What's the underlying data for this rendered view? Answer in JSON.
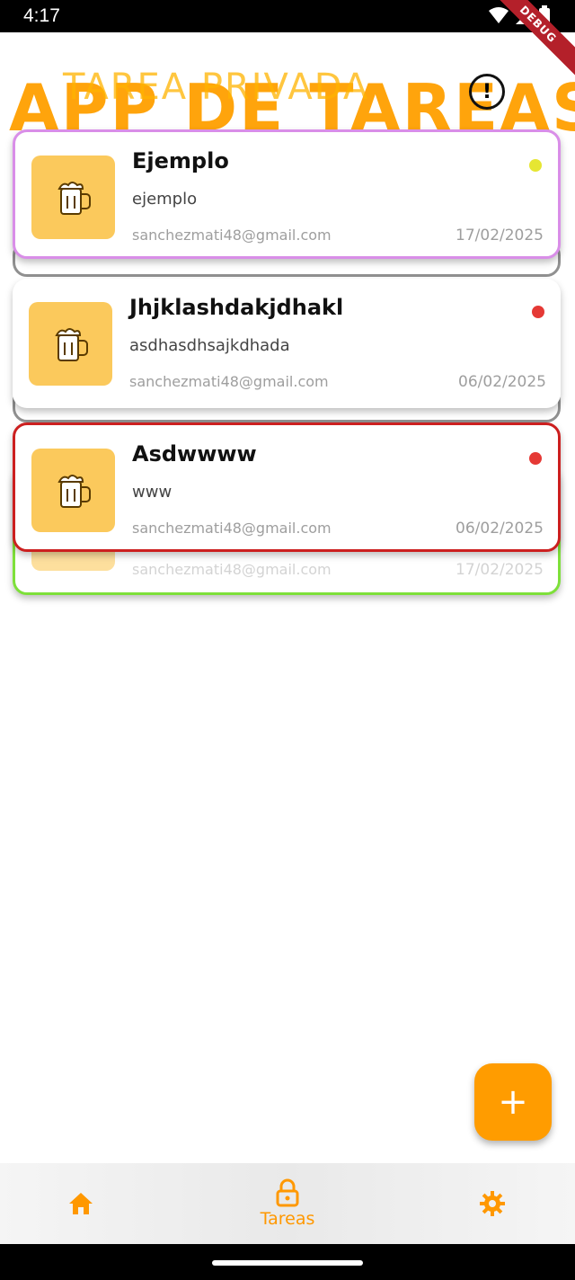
{
  "status_bar": {
    "time": "4:17",
    "debug_banner": "DEBUG"
  },
  "header": {
    "app_title": "APP DE TAREAS",
    "screen_title": "TAREA PRIVADA"
  },
  "tasks": [
    {
      "title": "Ejemplo",
      "description": "ejemplo",
      "email": "sanchezmati48@gmail.com",
      "date": "17/02/2025",
      "priority_color": "#e6e632",
      "border_color": "#d98ee8",
      "thumb_icon": "beer-mug-icon"
    },
    {
      "title": "Jhjklashdakjdhakl",
      "description": "asdhasdhsajkdhada",
      "email": "sanchezmati48@gmail.com",
      "date": "06/02/2025",
      "priority_color": "#e53935",
      "border_color": "",
      "thumb_icon": "beer-mug-icon"
    },
    {
      "title": "Asdwwww",
      "description": "www",
      "email": "sanchezmati48@gmail.com",
      "date": "06/02/2025",
      "priority_color": "#e53935",
      "border_color": "#cc1f1f",
      "thumb_icon": "beer-mug-icon"
    }
  ],
  "ghost_rows": [
    {
      "text": "sanchezmati48@gmail.com",
      "date": "17/02/2025",
      "border_color": "#7ee03a"
    }
  ],
  "fab": {
    "label": "+",
    "icon": "add-icon"
  },
  "bottom_nav": [
    {
      "label": "",
      "icon": "home-icon"
    },
    {
      "label": "Tareas",
      "icon": "lock-icon"
    },
    {
      "label": "",
      "icon": "gear-icon"
    }
  ],
  "colors": {
    "accent": "#ff9800",
    "thumb_bg": "#fbc95c"
  }
}
